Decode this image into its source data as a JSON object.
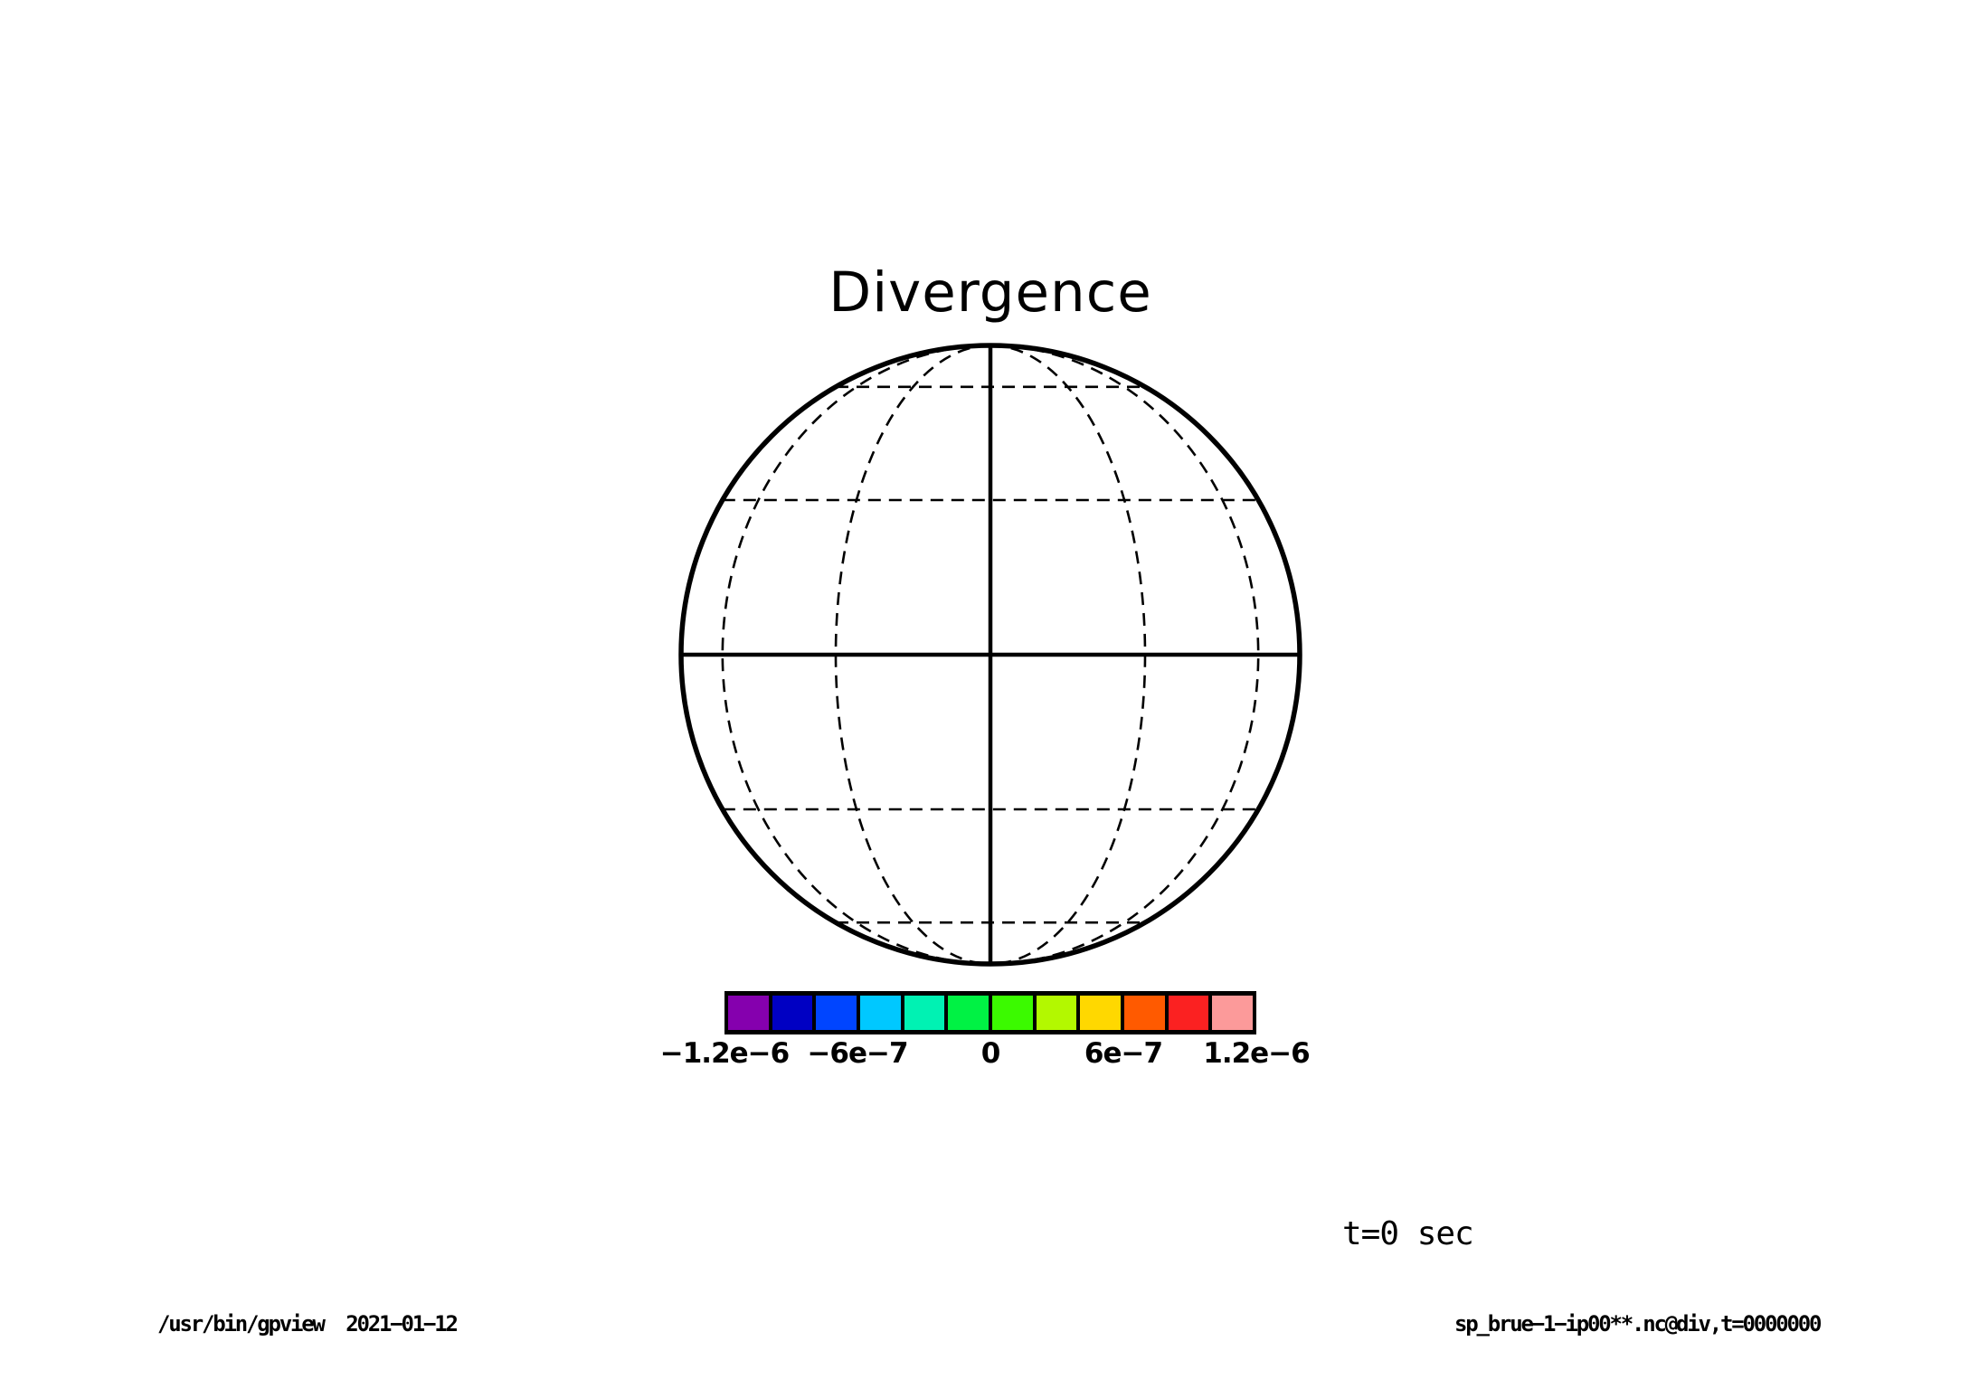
{
  "page": {
    "background": "#ffffff",
    "ink": "#000000"
  },
  "time_label": "t=0 sec",
  "footer": {
    "left": "/usr/bin/gpview  2021−01−12",
    "right": "sp_brue−1−ip00**.nc@div,t=0000000"
  },
  "chart_data": {
    "type": "map",
    "title": "Divergence",
    "projection": "orthographic-equatorial",
    "grid": "on",
    "graticule": {
      "interval_deg": 30,
      "solid_lines": [
        "limb",
        "equator",
        "central-meridian"
      ],
      "dashed_parallels_deg": [
        60,
        30,
        -30,
        -60
      ],
      "dashed_meridian_offsets_deg": [
        -60,
        -30,
        30,
        60
      ]
    },
    "shaded_field": "none (globe interior unshaded)",
    "colorbar": {
      "orientation": "horizontal",
      "min": -1.2e-06,
      "max": 1.2e-06,
      "n_cells": 12,
      "cell_colors": [
        "#8500AE",
        "#0000C3",
        "#0045FF",
        "#00C8FF",
        "#00F2B3",
        "#00F244",
        "#3BFA00",
        "#B3F800",
        "#FFD800",
        "#FF5A00",
        "#FB2121",
        "#FC9A9A"
      ],
      "ticks": [
        {
          "value": -1.2e-06,
          "label": "−1.2e−6"
        },
        {
          "value": -6e-07,
          "label": "−6e−7"
        },
        {
          "value": 0,
          "label": "0"
        },
        {
          "value": 6e-07,
          "label": "6e−7"
        },
        {
          "value": 1.2e-06,
          "label": "1.2e−6"
        }
      ]
    },
    "annotations": [
      "t=0 sec"
    ]
  }
}
